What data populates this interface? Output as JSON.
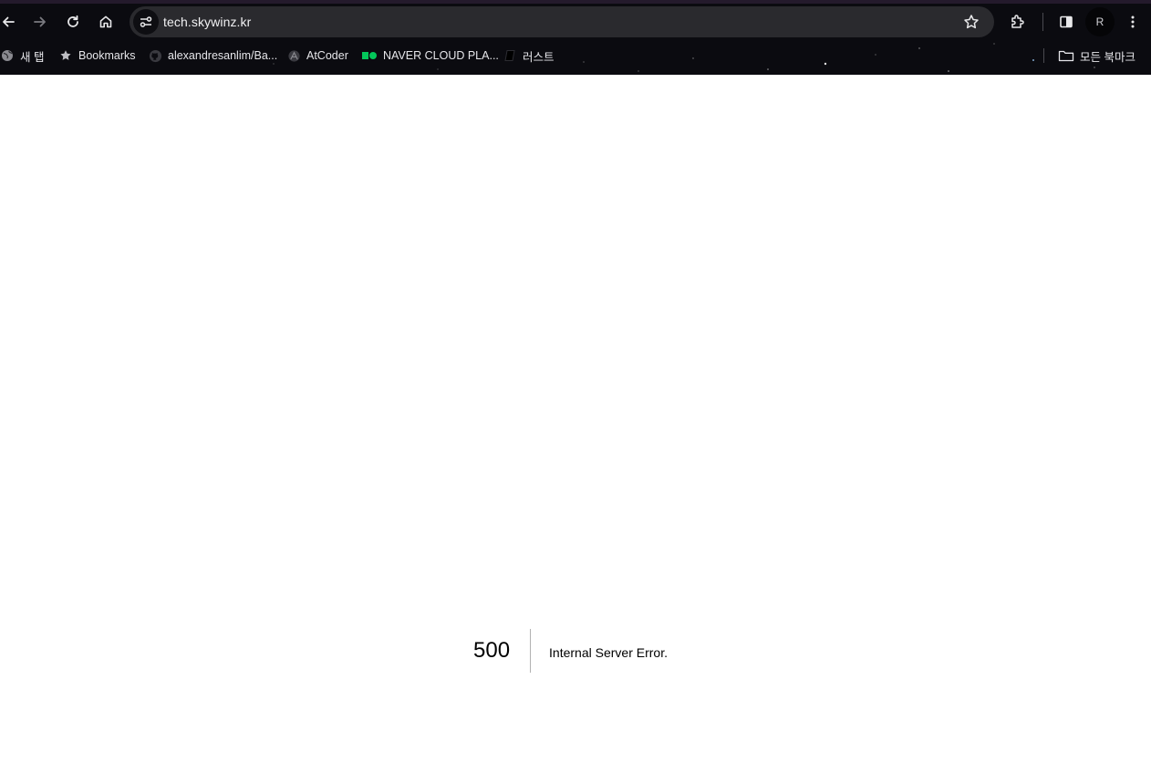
{
  "browser": {
    "url": "tech.skywinz.kr",
    "profile_initial": "R",
    "bookmarks": [
      {
        "label": "새 탭",
        "icon": "globe-icon"
      },
      {
        "label": "Bookmarks",
        "icon": "star-icon"
      },
      {
        "label": "alexandresanlim/Ba...",
        "icon": "github-icon"
      },
      {
        "label": "AtCoder",
        "icon": "atcoder-icon"
      },
      {
        "label": "NAVER CLOUD PLA...",
        "icon": "naver-cloud-icon"
      },
      {
        "label": "러스트",
        "icon": "book-icon"
      }
    ],
    "all_bookmarks_label": "모든 북마크"
  },
  "error": {
    "code": "500",
    "message": "Internal Server Error."
  },
  "colors": {
    "chrome_bg": "#0b0b10",
    "omnibox_bg": "#2a2a2e",
    "naver_green": "#03c75a"
  }
}
